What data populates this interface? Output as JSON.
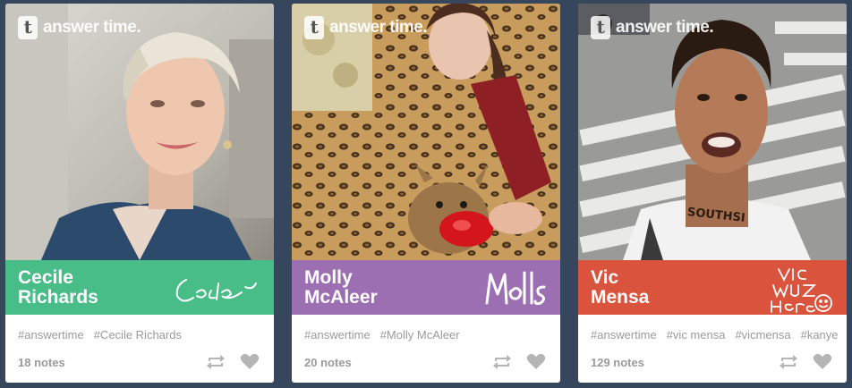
{
  "brand": {
    "name": "answer time.",
    "logo_letter": "t"
  },
  "colors": {
    "background": "#36465d",
    "card_1_banner": "#48bd87",
    "card_2_banner": "#9c6fb2",
    "card_3_banner": "#d9533d",
    "muted_text": "#9a9a9a",
    "icon": "#b5b5b5"
  },
  "cards": [
    {
      "first_name": "Cecile",
      "last_name": "Richards",
      "signature": "Cecile",
      "tags": [
        "#answertime",
        "#Cecile Richards"
      ],
      "notes": "18 notes",
      "photo_icon": "portrait-photo"
    },
    {
      "first_name": "Molly",
      "last_name": "McAleer",
      "signature": "Molls",
      "tags": [
        "#answertime",
        "#Molly McAleer"
      ],
      "notes": "20 notes",
      "photo_icon": "portrait-photo"
    },
    {
      "first_name": "Vic",
      "last_name": "Mensa",
      "signature": "VIC WUZ HERE",
      "tags": [
        "#answertime",
        "#vic mensa",
        "#vicmensa",
        "#kanye"
      ],
      "notes": "129 notes",
      "photo_icon": "portrait-photo"
    }
  ],
  "icons": {
    "reblog": "reblog-icon",
    "like": "heart-icon"
  }
}
